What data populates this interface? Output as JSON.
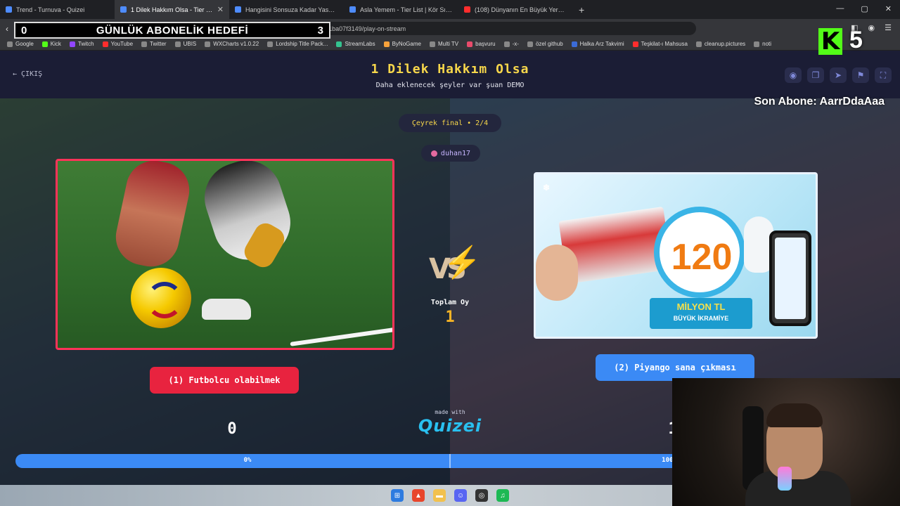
{
  "browser": {
    "tabs": [
      {
        "title": "Trend - Turnuva - Quizei",
        "active": false
      },
      {
        "title": "1 Dilek Hakkım Olsa - Tier List, K...",
        "active": true
      },
      {
        "title": "Hangisini Sonsuza Kadar Yasaklardın?",
        "active": false
      },
      {
        "title": "Asla Yemem - Tier List | Kör Sıralama",
        "active": false
      },
      {
        "title": "(108) Dünyanın En Büyük Yeraltı Topl...",
        "active": false
      }
    ],
    "url": "ournament/quiz/677780...097041ba07f3149/play-on-stream",
    "bookmarks": [
      "Google",
      "Kick",
      "Twitch",
      "YouTube",
      "Twitter",
      "UBIS",
      "WXCharts v1.0.22",
      "Lordship Title Pack...",
      "StreamLabs",
      "ByNoGame",
      "Multi TV",
      "başvuru",
      "-x-",
      "özel github",
      "Halka Arz Takvimi",
      "Teşkilat-ı Mahsusa",
      "cleanup.pictures",
      "noti"
    ]
  },
  "overlay": {
    "goal_title": "GÜNLÜK ABONELİK HEDEFİ",
    "goal_min": "0",
    "goal_max": "3",
    "kick_letter": "K",
    "kick_count": "5",
    "last_sub": "Son Abone: AarrDdaAaa"
  },
  "header": {
    "exit_label": "ÇIKIŞ",
    "title": "1 Dilek Hakkım Olsa",
    "subtitle": "Daha eklenecek şeyler var şuan DEMO",
    "icons": [
      "eye-icon",
      "copy-icon",
      "send-icon",
      "flag-icon",
      "fullscreen-icon"
    ]
  },
  "match": {
    "round": "Çeyrek final • 2/4",
    "user": "duhan17",
    "left": {
      "label": "(1) Futbolcu olabilmek",
      "score": "0",
      "percent": "0%",
      "color": "#e8233f"
    },
    "right": {
      "label": "(2) Piyango sana çıkması",
      "score": "1",
      "percent": "100%",
      "color": "#3b8af5"
    },
    "vs": "VS",
    "total_label": "Toplam Oy",
    "total_votes": "1",
    "made_with": "made with",
    "brand": "Quizei",
    "left_share": 0
  },
  "images": {
    "right_prize_number": "120",
    "right_prize_line1": "MİLYON TL",
    "right_prize_line2": "BÜYÜK İKRAMİYE"
  },
  "colors": {
    "accent_yellow": "#f7d74b",
    "left_red": "#e8233f",
    "right_blue": "#3b8af5",
    "header_bg": "#1b1d35"
  }
}
